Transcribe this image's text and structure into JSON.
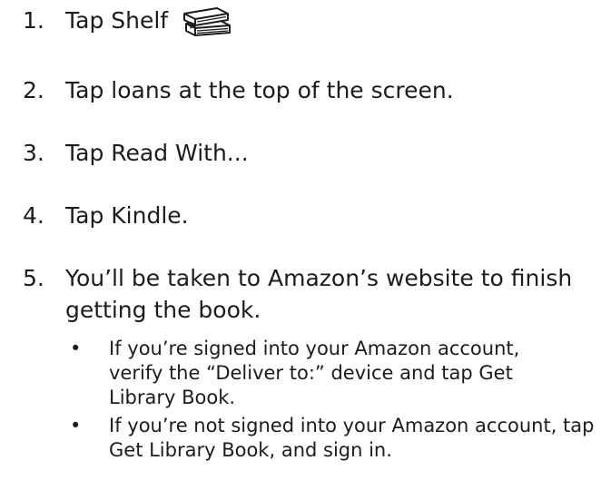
{
  "steps": [
    {
      "num": "1.",
      "text": "Tap Shelf"
    },
    {
      "num": "2.",
      "text": "Tap loans at the top of the screen."
    },
    {
      "num": "3.",
      "text": "Tap Read With..."
    },
    {
      "num": "4.",
      "text": "Tap Kindle."
    },
    {
      "num": "5.",
      "text": "You’ll be taken to Amazon’s website to finish getting the book."
    }
  ],
  "sub_items": [
    {
      "bullet": "•",
      "text": "If you’re signed into your Amazon account, verify the “Deliver to:” device and tap Get Library Book."
    },
    {
      "bullet": "•",
      "text": "If you’re not signed into your Amazon account, tap Get Library Book, and sign in."
    }
  ],
  "icons": {
    "shelf": "shelf-books-icon"
  }
}
